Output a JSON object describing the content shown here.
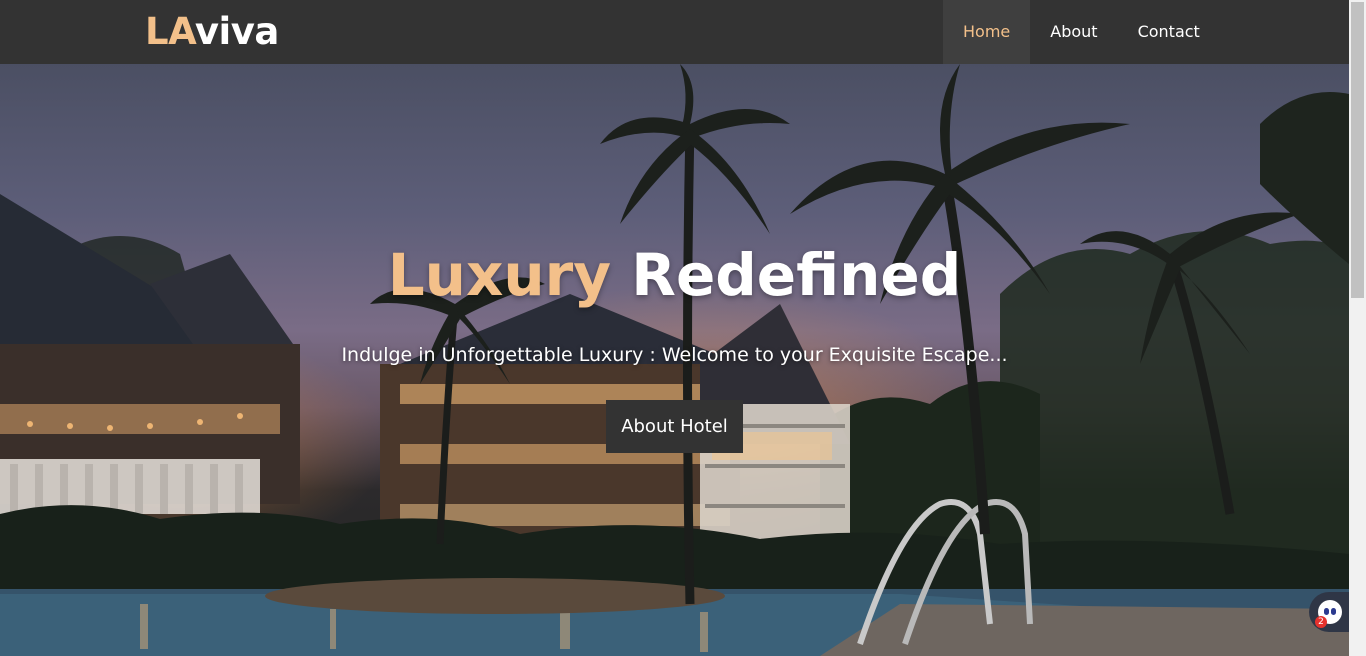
{
  "navbar": {
    "logo_accent": "LA",
    "logo_rest": "viva",
    "links": [
      {
        "label": "Home",
        "active": true
      },
      {
        "label": "About",
        "active": false
      },
      {
        "label": "Contact",
        "active": false
      }
    ]
  },
  "hero": {
    "title_accent": "Luxury",
    "title_rest": "Redefined",
    "subtitle": "Indulge in Unforgettable Luxury : Welcome to your Exquisite Escape...",
    "button_label": "About Hotel"
  },
  "chat_widget": {
    "icon": "chat-bot-icon",
    "badge_count": "2"
  },
  "colors": {
    "accent": "#f3c08a",
    "navbar_bg": "#333333",
    "button_bg": "#333333",
    "text": "#ffffff"
  }
}
